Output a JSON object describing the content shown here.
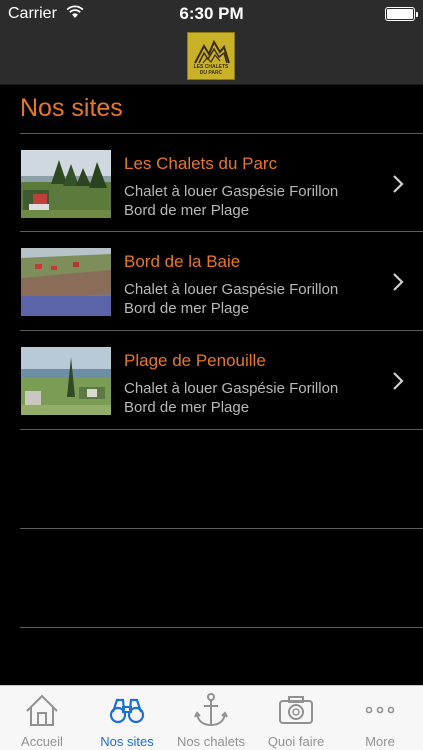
{
  "status_bar": {
    "carrier": "Carrier",
    "time": "6:30 PM"
  },
  "header": {
    "logo_line1": "LES CHALETS",
    "logo_line2": "DU PARC"
  },
  "page_title": "Nos sites",
  "sites": [
    {
      "title": "Les Chalets du Parc",
      "desc": "Chalet à louer Gaspésie Forillon Bord de mer Plage"
    },
    {
      "title": "Bord de la Baie",
      "desc": "Chalet à louer Gaspésie Forillon Bord de mer Plage"
    },
    {
      "title": "Plage de Penouille",
      "desc": "Chalet à louer Gaspésie Forillon Bord de mer Plage"
    }
  ],
  "tabs": [
    {
      "label": "Accueil",
      "icon": "house-icon",
      "active": false
    },
    {
      "label": "Nos sites",
      "icon": "binoculars-icon",
      "active": true
    },
    {
      "label": "Nos chalets",
      "icon": "anchor-icon",
      "active": false
    },
    {
      "label": "Quoi faire",
      "icon": "camera-icon",
      "active": false
    },
    {
      "label": "More",
      "icon": "more-dots-icon",
      "active": false
    }
  ],
  "colors": {
    "accent": "#e8772c",
    "tab_active": "#1d6fd4",
    "tab_inactive": "#929292",
    "bar": "#2c2c2c"
  }
}
